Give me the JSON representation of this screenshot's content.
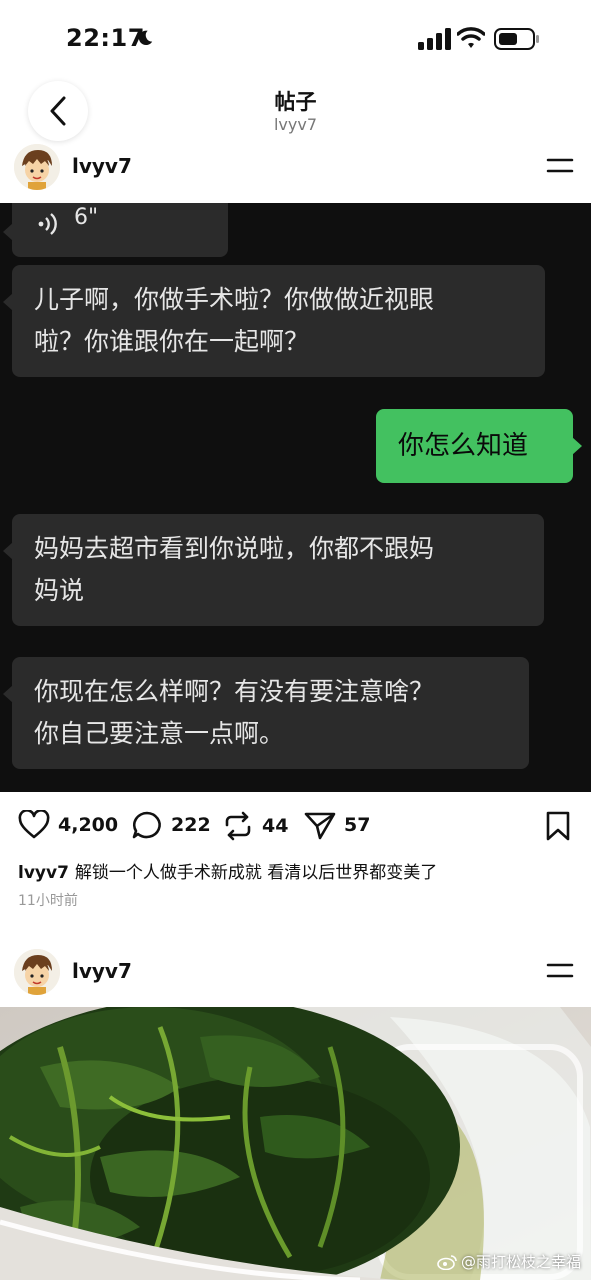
{
  "status_bar": {
    "time": "22:17"
  },
  "header": {
    "title": "帖子",
    "subtitle": "lvyv7"
  },
  "post1": {
    "username": "lvyv7",
    "chat": {
      "voice_duration": "6\"",
      "messages": [
        {
          "side": "left",
          "lines": [
            "儿子啊，你做手术啦？你做做近视眼",
            "啦？你谁跟你在一起啊？"
          ]
        },
        {
          "side": "right",
          "lines": [
            "你怎么知道"
          ]
        },
        {
          "side": "left",
          "lines": [
            "妈妈去超市看到你说啦，你都不跟妈",
            "妈说"
          ]
        },
        {
          "side": "left",
          "lines": [
            "你现在怎么样啊？有没有要注意啥？",
            "你自己要注意一点啊。"
          ]
        }
      ]
    },
    "actions": {
      "likes": "4,200",
      "comments": "222",
      "reposts": "44",
      "shares": "57"
    },
    "caption_user": "lvyv7",
    "caption_text": "解锁一个人做手术新成就 看清以后世界都变美了",
    "time_ago": "11小时前"
  },
  "post2": {
    "username": "lvyv7"
  },
  "watermark": "@雨打松枝之幸福",
  "colors": {
    "chat_bg": "#0f0f0f",
    "bubble_gray": "#2b2b2b",
    "bubble_green": "#43c160"
  }
}
